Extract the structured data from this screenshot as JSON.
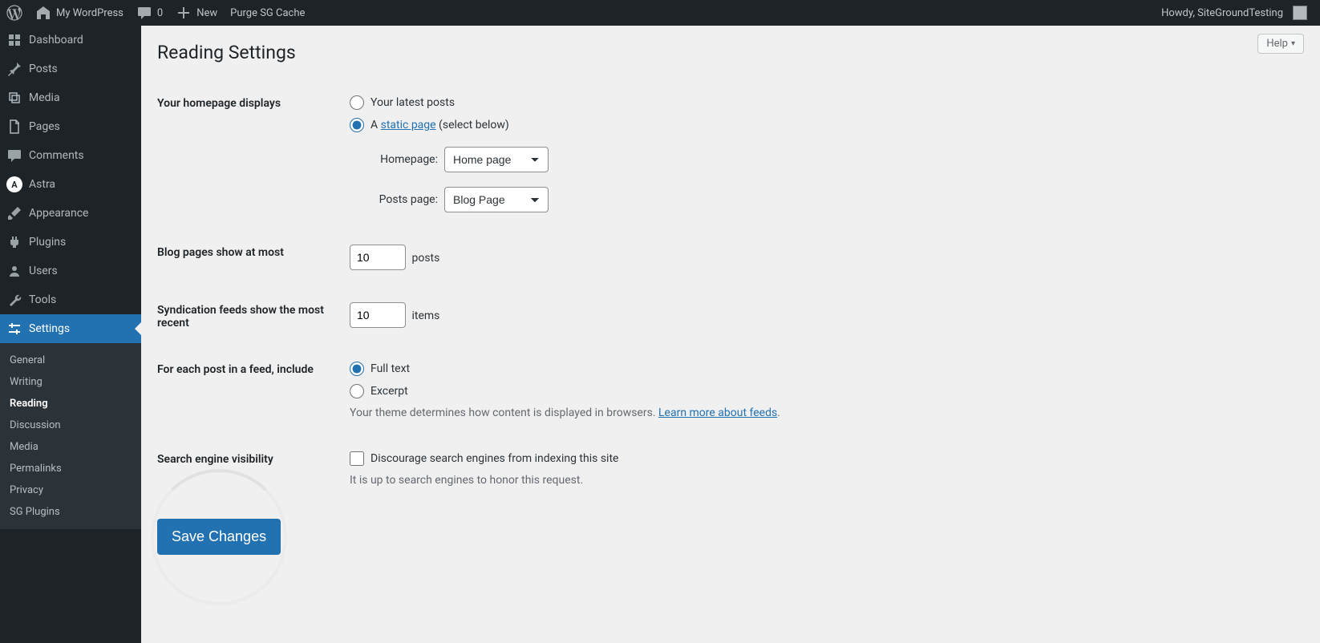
{
  "adminbar": {
    "site_name": "My WordPress",
    "comments_count": "0",
    "new_label": "New",
    "purge_label": "Purge SG Cache",
    "howdy": "Howdy, SiteGroundTesting"
  },
  "sidebar": {
    "items": [
      {
        "label": "Dashboard"
      },
      {
        "label": "Posts"
      },
      {
        "label": "Media"
      },
      {
        "label": "Pages"
      },
      {
        "label": "Comments"
      },
      {
        "label": "Astra"
      },
      {
        "label": "Appearance"
      },
      {
        "label": "Plugins"
      },
      {
        "label": "Users"
      },
      {
        "label": "Tools"
      },
      {
        "label": "Settings"
      }
    ],
    "submenu": [
      {
        "label": "General"
      },
      {
        "label": "Writing"
      },
      {
        "label": "Reading"
      },
      {
        "label": "Discussion"
      },
      {
        "label": "Media"
      },
      {
        "label": "Permalinks"
      },
      {
        "label": "Privacy"
      },
      {
        "label": "SG Plugins"
      }
    ]
  },
  "page": {
    "help": "Help",
    "title": "Reading Settings",
    "homepage_label": "Your homepage displays",
    "opt_latest": "Your latest posts",
    "opt_static_prefix": "A ",
    "opt_static_link": "static page",
    "opt_static_suffix": " (select below)",
    "homepage_select_label": "Homepage:",
    "homepage_select_value": "Home page",
    "postspage_select_label": "Posts page:",
    "postspage_select_value": "Blog Page",
    "blog_pages_label": "Blog pages show at most",
    "blog_pages_value": "10",
    "blog_pages_unit": "posts",
    "syndication_label": "Syndication feeds show the most recent",
    "syndication_value": "10",
    "syndication_unit": "items",
    "feed_include_label": "For each post in a feed, include",
    "opt_fulltext": "Full text",
    "opt_excerpt": "Excerpt",
    "feed_desc_prefix": "Your theme determines how content is displayed in browsers. ",
    "feed_desc_link": "Learn more about feeds",
    "feed_desc_suffix": ".",
    "search_label": "Search engine visibility",
    "search_checkbox": "Discourage search engines from indexing this site",
    "search_desc": "It is up to search engines to honor this request.",
    "save": "Save Changes"
  }
}
